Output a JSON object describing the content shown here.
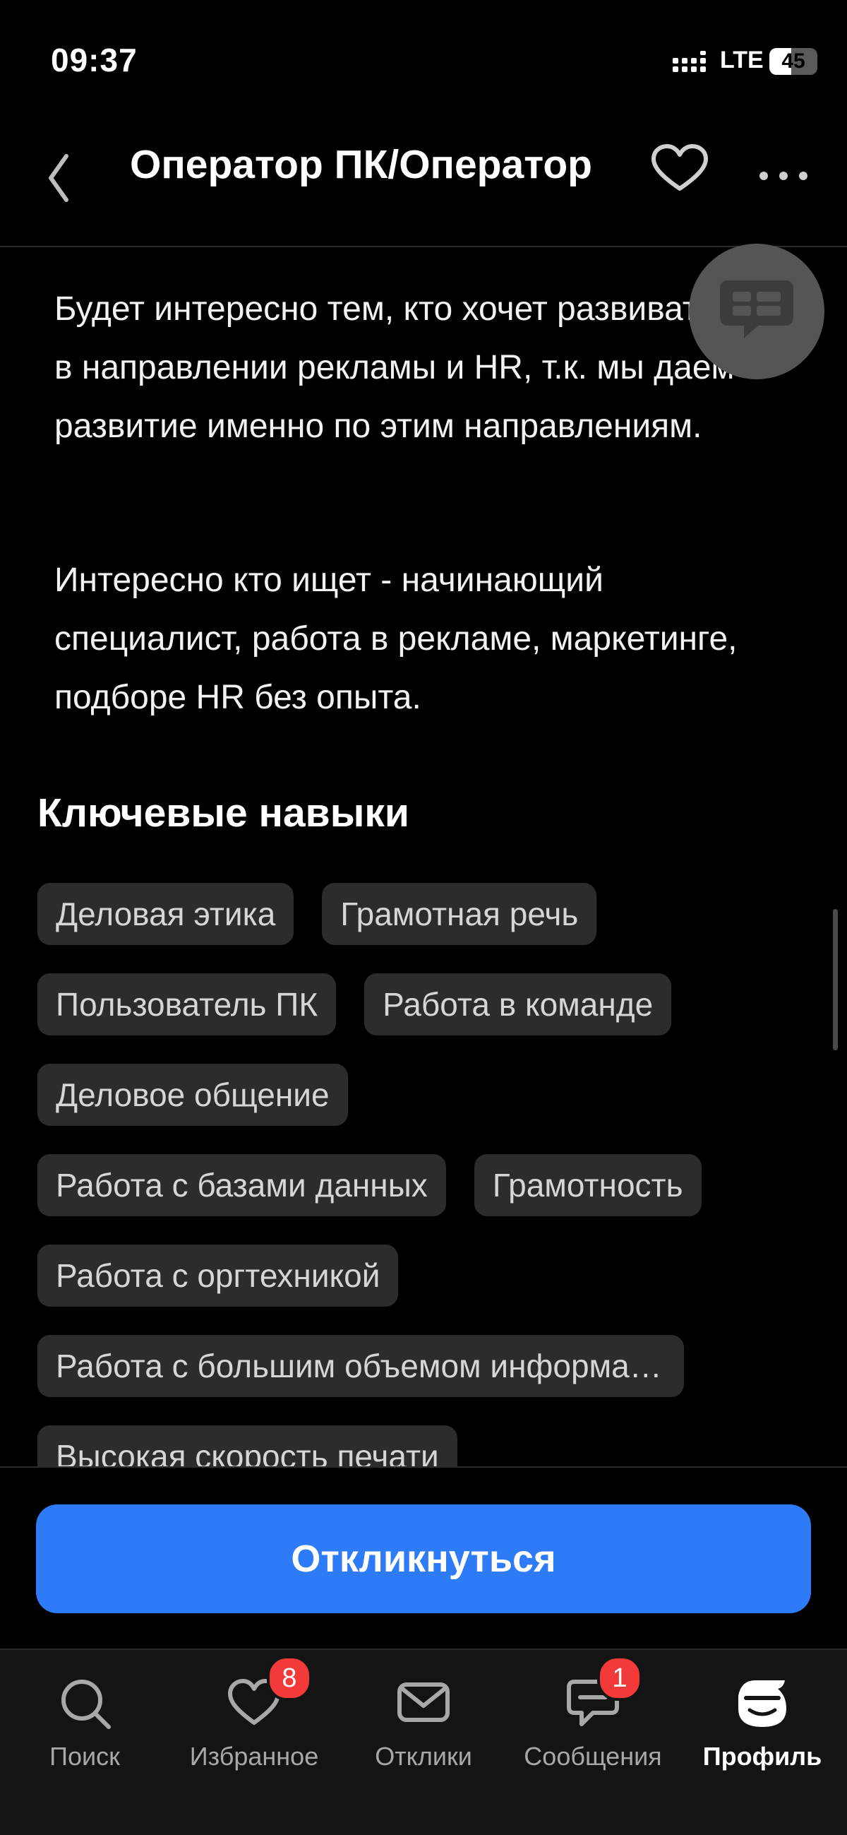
{
  "status_bar": {
    "time": "09:37",
    "network": "LTE",
    "battery": "45",
    "battery_level": 0.45
  },
  "header": {
    "back_icon": "chevron-left-icon",
    "title": "Оператор ПК/Оператор",
    "favorite_icon": "heart-outline-icon",
    "more_icon": "more-horizontal-icon"
  },
  "description": {
    "paragraph_1": "Будет интересно тем, кто хочет развиваться в направлении рекламы и HR, т.к. мы даем развитие именно по этим направлениям.",
    "paragraph_2": "Интересно кто ищет - начинающий специалист, работа в рекламе, маркетинге, подборе HR без опыта."
  },
  "chat_fab": {
    "icon": "chat-bubble-icon"
  },
  "skills": {
    "title": "Ключевые навыки",
    "rows": [
      [
        "Деловая этика",
        "Грамотная речь"
      ],
      [
        "Пользователь ПК",
        "Работа в команде"
      ],
      [
        "Деловое общение"
      ],
      [
        "Работа с базами данных",
        "Грамотность"
      ],
      [
        "Работа с оргтехникой"
      ],
      [
        "Работа с большим объемом информации"
      ],
      [
        "Высокая скорость печати"
      ]
    ]
  },
  "action": {
    "respond_label": "Откликнуться"
  },
  "tabs": [
    {
      "label": "Поиск",
      "icon": "search-icon",
      "badge": ""
    },
    {
      "label": "Избранное",
      "icon": "heart-icon",
      "badge": "8"
    },
    {
      "label": "Отклики",
      "icon": "envelope-icon",
      "badge": ""
    },
    {
      "label": "Сообщения",
      "icon": "chat-icon",
      "badge": "1"
    },
    {
      "label": "Профиль",
      "icon": "profile-avatar-icon",
      "badge": "",
      "active": true
    }
  ],
  "colors": {
    "accent": "#2d7bf6",
    "badge": "#f33a3a",
    "chip_bg": "#2c2c2e",
    "background": "#000000"
  }
}
